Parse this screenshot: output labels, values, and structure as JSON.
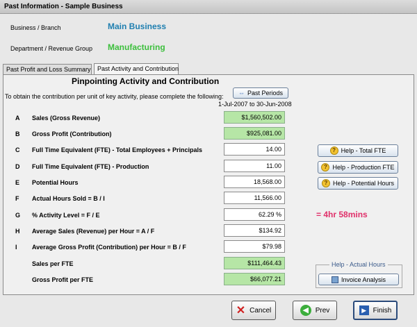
{
  "window": {
    "title": "Past Information - Sample Business"
  },
  "header": {
    "business_label": "Business / Branch",
    "business_value": "Main Business",
    "dept_label": "Department / Revenue Group",
    "dept_value": "Manufacturing"
  },
  "tabs": [
    {
      "label": "Past Profit and Loss Summary"
    },
    {
      "label": "Past Activity and Contribution"
    }
  ],
  "panel": {
    "title": "Pinpointing Activity and Contribution",
    "intro": "To obtain the contribution per unit of key activity, please complete the following:",
    "past_periods_label": "Past Periods",
    "period_range": "1-Jul-2007 to 30-Jun-2008"
  },
  "rows": [
    {
      "letter": "A",
      "label": "Sales (Gross Revenue)",
      "value": "$1,560,502.00"
    },
    {
      "letter": "B",
      "label": "Gross Profit (Contribution)",
      "value": "$925,081.00"
    },
    {
      "letter": "C",
      "label": "Full Time Equivalent (FTE) - Total Employees + Principals",
      "value": "14.00"
    },
    {
      "letter": "D",
      "label": "Full Time Equivalent (FTE) - Production",
      "value": "11.00"
    },
    {
      "letter": "E",
      "label": "Potential Hours",
      "value": "18,568.00"
    },
    {
      "letter": "F",
      "label": "Actual Hours Sold = B / I",
      "value": "11,566.00"
    },
    {
      "letter": "G",
      "label": "% Activity Level = F / E",
      "value": "62.29 %"
    },
    {
      "letter": "H",
      "label": "Average Sales (Revenue) per Hour = A / F",
      "value": "$134.92"
    },
    {
      "letter": "I",
      "label": "Average Gross Profit (Contribution) per Hour = B / F",
      "value": "$79.98"
    },
    {
      "letter": "",
      "label": "Sales per FTE",
      "value": "$111,464.43"
    },
    {
      "letter": "",
      "label": "Gross Profit per FTE",
      "value": "$66,077.21"
    }
  ],
  "help": {
    "total_fte": "Help - Total FTE",
    "production_fte": "Help - Production FTE",
    "potential_hours": "Help - Potential Hours",
    "actual_hours_group": "Help - Actual Hours",
    "invoice_analysis": "Invoice Analysis",
    "icon": "question-icon"
  },
  "note": "= 4hr 58mins",
  "footer": {
    "cancel": "Cancel",
    "prev": "Prev",
    "finish": "Finish"
  },
  "colors": {
    "business": "#1f7fb0",
    "department": "#3cbf3c",
    "note": "#e0306a",
    "calc_field": "#b6e6a6"
  }
}
